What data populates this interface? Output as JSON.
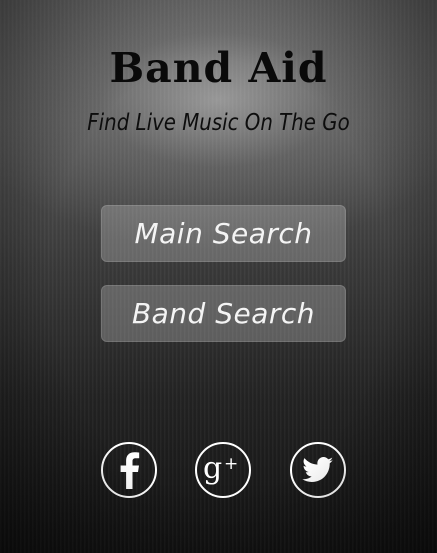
{
  "app": {
    "title": "Band Aid",
    "tagline": "Find Live Music On The Go"
  },
  "menu": {
    "main_search_label": "Main Search",
    "band_search_label": "Band Search"
  },
  "social": [
    {
      "icon": "facebook-icon"
    },
    {
      "icon": "google-plus-icon"
    },
    {
      "icon": "twitter-icon"
    }
  ],
  "colors": {
    "button_text": "#f4f4f4",
    "title_text": "#0a0a0a",
    "icon_stroke": "#ffffff"
  }
}
